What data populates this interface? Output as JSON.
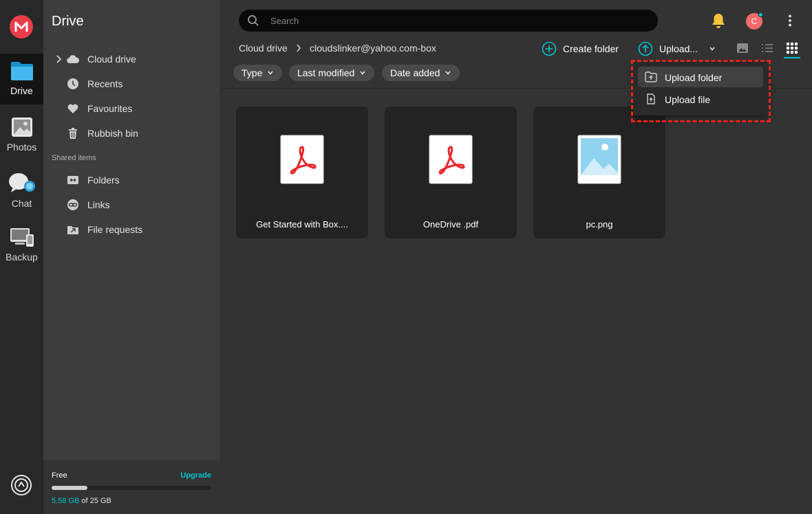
{
  "rail": {
    "items": [
      {
        "label": "Drive"
      },
      {
        "label": "Photos"
      },
      {
        "label": "Chat"
      },
      {
        "label": "Backup"
      }
    ]
  },
  "sidebar": {
    "title": "Drive",
    "items": [
      {
        "label": "Cloud drive",
        "icon": "cloud-icon"
      },
      {
        "label": "Recents",
        "icon": "clock-icon"
      },
      {
        "label": "Favourites",
        "icon": "heart-icon"
      },
      {
        "label": "Rubbish bin",
        "icon": "trash-icon"
      }
    ],
    "shared_label": "Shared items",
    "shared_items": [
      {
        "label": "Folders",
        "icon": "shared-folder-icon"
      },
      {
        "label": "Links",
        "icon": "link-icon"
      },
      {
        "label": "File requests",
        "icon": "file-request-icon"
      }
    ]
  },
  "storage": {
    "plan": "Free",
    "upgrade": "Upgrade",
    "used": "5.58 GB",
    "total": " of 25 GB",
    "used_fraction": 0.2232
  },
  "search": {
    "placeholder": "Search"
  },
  "avatar": {
    "initial": "C"
  },
  "breadcrumb": {
    "root": "Cloud drive",
    "current": "cloudslinker@yahoo.com-box"
  },
  "toolbar": {
    "create_folder": "Create folder",
    "upload": "Upload..."
  },
  "filters": [
    "Type",
    "Last modified",
    "Date added"
  ],
  "files": [
    {
      "name": "Get Started with Box....",
      "kind": "pdf"
    },
    {
      "name": "OneDrive .pdf",
      "kind": "pdf"
    },
    {
      "name": "pc.png",
      "kind": "image"
    }
  ],
  "upload_menu": {
    "upload_folder": "Upload folder",
    "upload_file": "Upload file"
  },
  "colors": {
    "accent": "#00c4ce",
    "brand": "#ea3d4a",
    "highlight": "#e8261c"
  }
}
